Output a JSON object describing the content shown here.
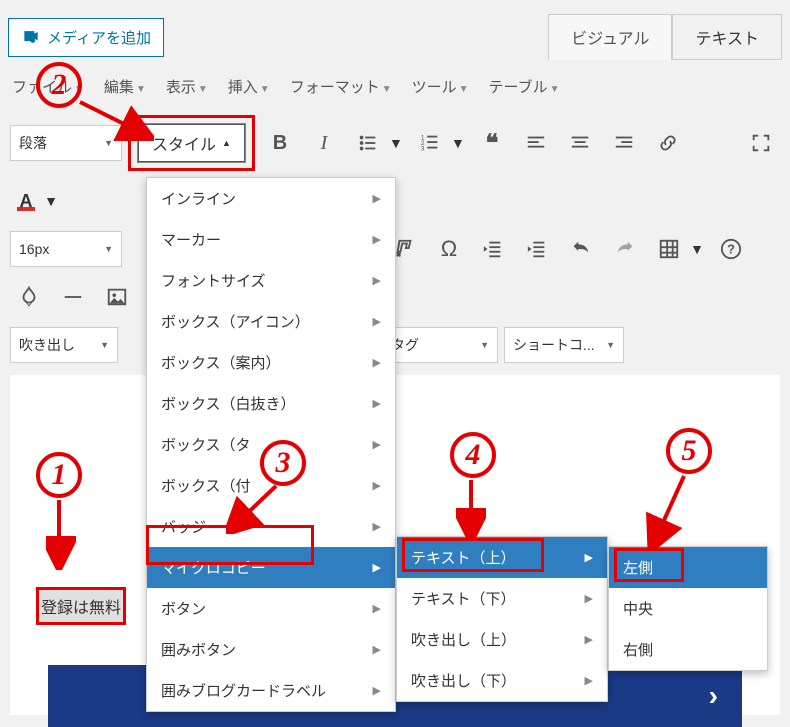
{
  "topbar": {
    "media_button": "メディアを追加"
  },
  "tabs": {
    "visual": "ビジュアル",
    "text": "テキスト"
  },
  "menubar": {
    "file": "ファイル",
    "edit": "編集",
    "view": "表示",
    "insert": "挿入",
    "format": "フォーマット",
    "tools": "ツール",
    "table": "テーブル"
  },
  "toolbar": {
    "row1": {
      "paragraph_sel": "段落",
      "style_btn": "スタイル"
    },
    "row3": {
      "fontsize_sel": "16px"
    },
    "row5": {
      "fukidashi_sel": "吹き出し",
      "tag_sel": "タグ",
      "shortcode_sel": "ショートコ..."
    }
  },
  "style_menu": {
    "items": [
      "インライン",
      "マーカー",
      "フォントサイズ",
      "ボックス（アイコン）",
      "ボックス（案内）",
      "ボックス（白抜き）",
      "ボックス（タ",
      "ボックス（付",
      "バッジ",
      "マイクロコピー",
      "ボタン",
      "囲みボタン",
      "囲みブログカードラベル"
    ]
  },
  "submenu_microcopy": {
    "items": [
      "テキスト（上）",
      "テキスト（下）",
      "吹き出し（上）",
      "吹き出し（下）"
    ]
  },
  "submenu_position": {
    "items": [
      "左側",
      "中央",
      "右側"
    ]
  },
  "content": {
    "sample_text": "登録は無料"
  },
  "annotations": {
    "n1": "1",
    "n2": "2",
    "n3": "3",
    "n4": "4",
    "n5": "5"
  }
}
